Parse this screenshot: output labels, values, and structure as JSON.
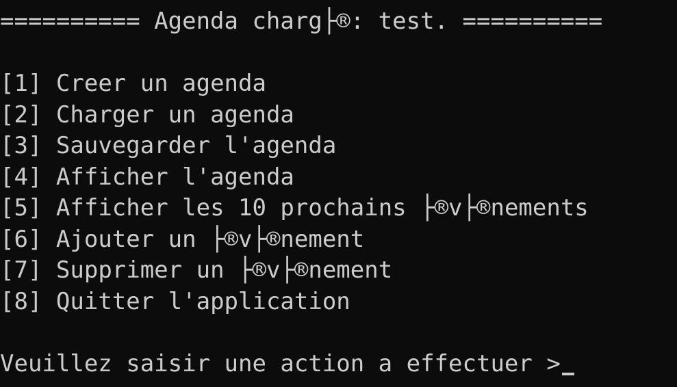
{
  "console": {
    "header": "========== Agenda charg├®: test. ==========",
    "menu": [
      {
        "key": "[1]",
        "label": "Creer un agenda"
      },
      {
        "key": "[2]",
        "label": "Charger un agenda"
      },
      {
        "key": "[3]",
        "label": "Sauvegarder l'agenda"
      },
      {
        "key": "[4]",
        "label": "Afficher l'agenda"
      },
      {
        "key": "[5]",
        "label": "Afficher les 10 prochains ├®v├®nements"
      },
      {
        "key": "[6]",
        "label": "Ajouter un ├®v├®nement"
      },
      {
        "key": "[7]",
        "label": "Supprimer un ├®v├®nement"
      },
      {
        "key": "[8]",
        "label": "Quitter l'application"
      }
    ],
    "prompt": "Veuillez saisir une action a effectuer >"
  },
  "colors": {
    "background": "#0c0c0c",
    "text": "#cccccc"
  }
}
